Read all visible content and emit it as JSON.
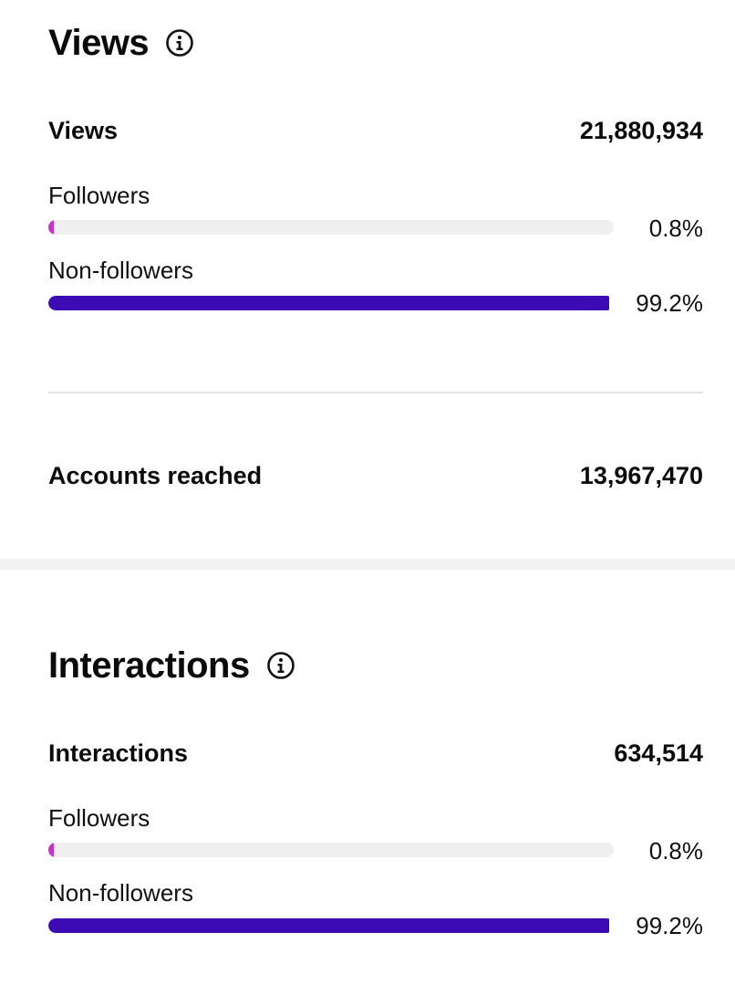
{
  "views": {
    "title": "Views",
    "metric_label": "Views",
    "metric_value": "21,880,934",
    "followers": {
      "label": "Followers",
      "percent_text": "0.8%",
      "fraction": 0.008
    },
    "non_followers": {
      "label": "Non-followers",
      "percent_text": "99.2%",
      "fraction": 0.992
    },
    "accounts_reached_label": "Accounts reached",
    "accounts_reached_value": "13,967,470"
  },
  "interactions": {
    "title": "Interactions",
    "metric_label": "Interactions",
    "metric_value": "634,514",
    "followers": {
      "label": "Followers",
      "percent_text": "0.8%",
      "fraction": 0.008
    },
    "non_followers": {
      "label": "Non-followers",
      "percent_text": "99.2%",
      "fraction": 0.992
    }
  },
  "colors": {
    "followers_bar": "#c932c8",
    "non_followers_bar": "#3d0bb5",
    "track": "#efefef"
  },
  "icons": {
    "info": "info-circle-icon"
  }
}
